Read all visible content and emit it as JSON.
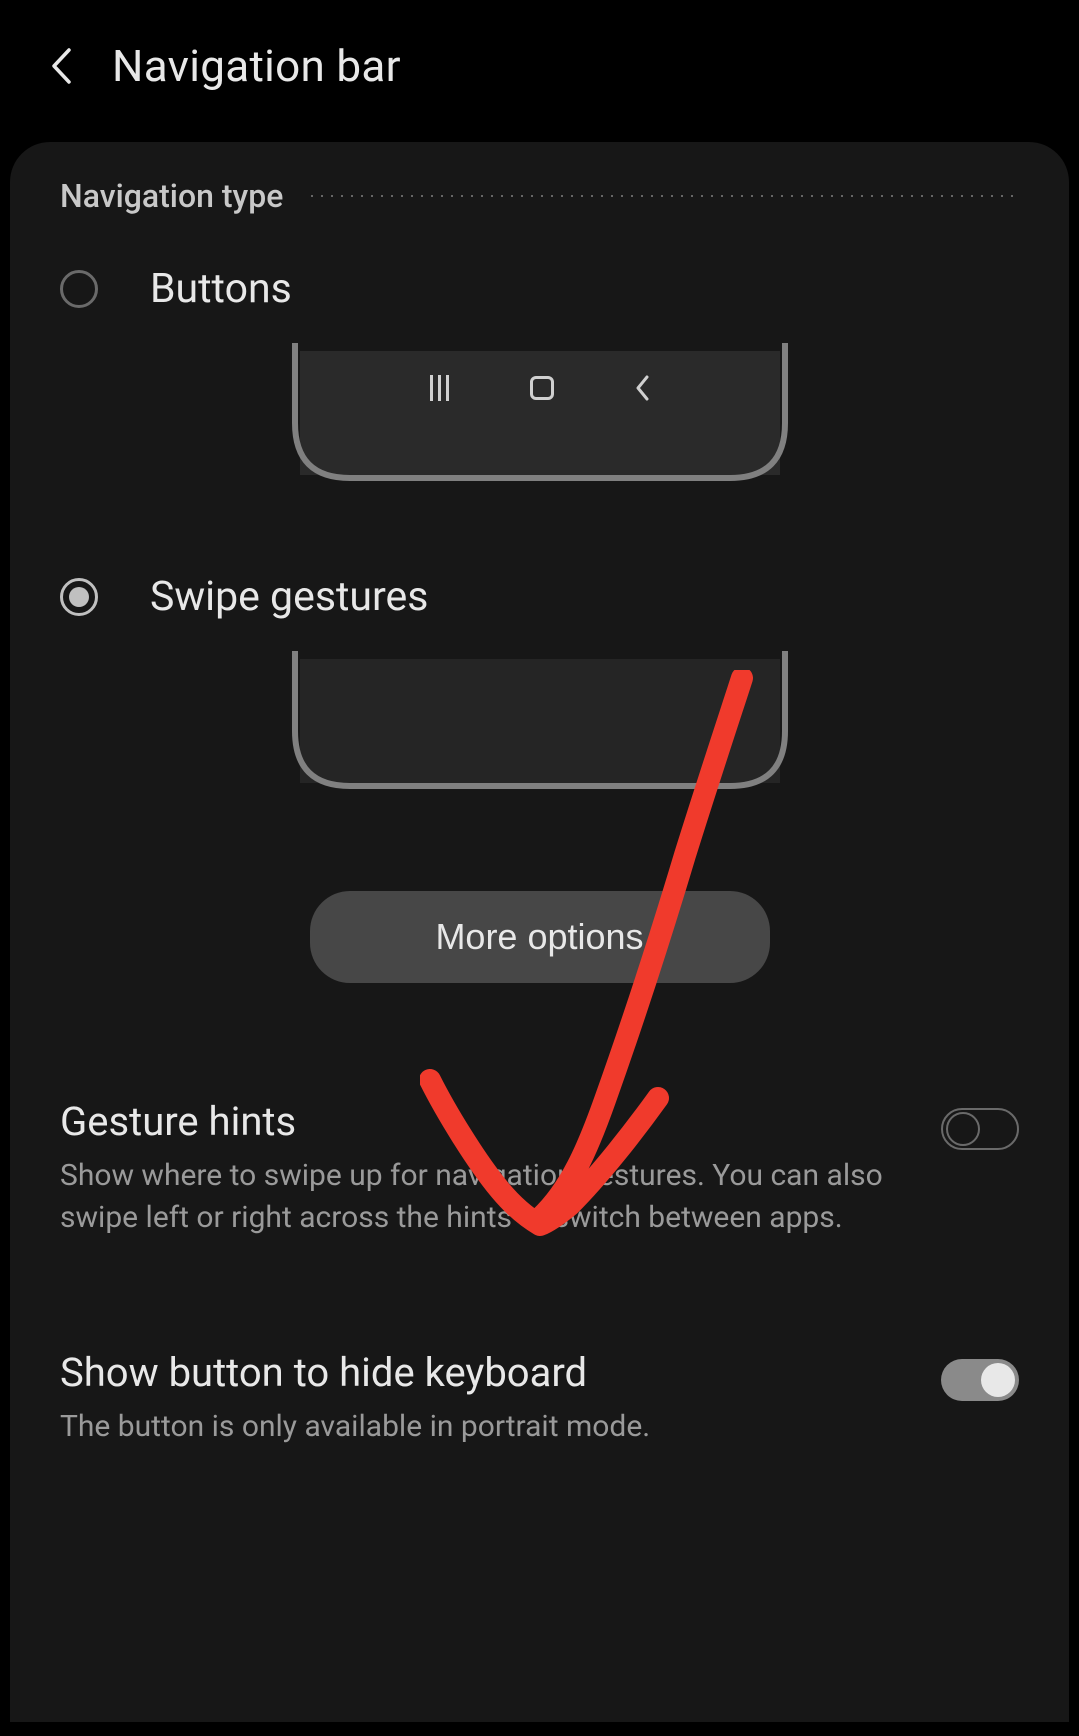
{
  "header": {
    "title": "Navigation bar"
  },
  "nav_type": {
    "section_title": "Navigation type",
    "options": {
      "buttons": {
        "label": "Buttons",
        "selected": false
      },
      "swipe": {
        "label": "Swipe gestures",
        "selected": true
      }
    },
    "more_options_label": "More options"
  },
  "settings": {
    "gesture_hints": {
      "title": "Gesture hints",
      "desc": "Show where to swipe up for navigation gestures. You can also swipe left or right across the hints to switch between apps.",
      "enabled": false
    },
    "hide_keyboard": {
      "title": "Show button to hide keyboard",
      "desc": "The button is only available in portrait mode.",
      "enabled": true
    }
  },
  "annotation": {
    "arrow_color": "#f03a2c"
  }
}
